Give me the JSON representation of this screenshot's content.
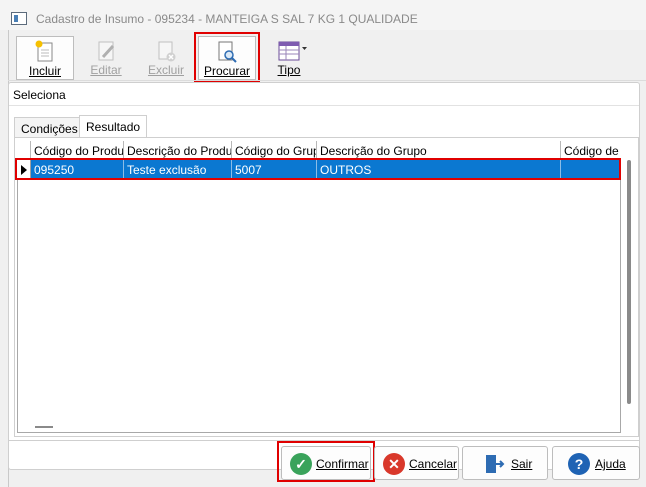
{
  "window": {
    "title": "Cadastro de Insumo - 095234 - MANTEIGA S  SAL 7 KG  1  QUALIDADE"
  },
  "toolbar": {
    "incluir": "Incluir",
    "editar": "Editar",
    "excluir": "Excluir",
    "procurar": "Procurar",
    "tipo": "Tipo"
  },
  "panel": {
    "heading": "Seleciona"
  },
  "tabs": [
    {
      "label": "Condições"
    },
    {
      "label": "Resultado"
    }
  ],
  "grid": {
    "columns": [
      "Código do Produto",
      "Descrição do Produto",
      "Código do Grupo",
      "Descrição do Grupo",
      "Código de E"
    ],
    "rows": [
      {
        "codigo_produto": "095250",
        "descricao_produto": "Teste exclusão",
        "codigo_grupo": "5007",
        "descricao_grupo": "OUTROS",
        "codigo_e": ""
      }
    ]
  },
  "buttons": {
    "confirmar": "Confirmar",
    "cancelar": "Cancelar",
    "sair": "Sair",
    "ajuda": "Ajuda"
  },
  "colors": {
    "selection": "#0b78d1",
    "highlight": "#e00000",
    "confirm": "#3aa35b",
    "cancel": "#d9382b",
    "help": "#1f63b4"
  }
}
